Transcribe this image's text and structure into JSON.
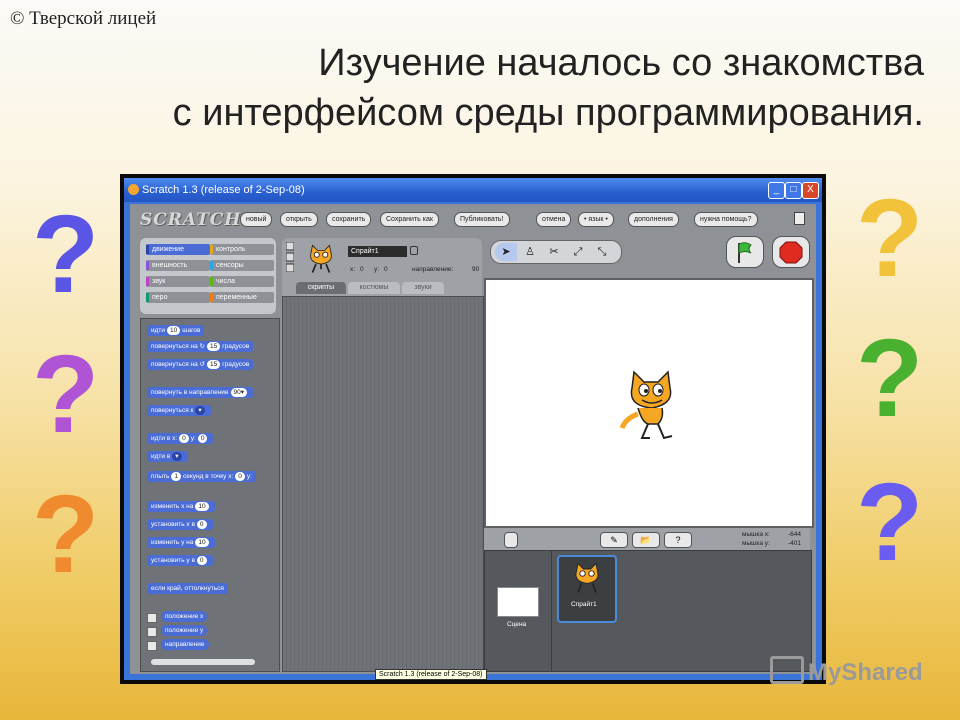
{
  "slide": {
    "copyright": "© Тверской лицей",
    "title_line1": "Изучение началось со знакомства",
    "title_line2": "с интерфейсом среды программирования.",
    "watermark": "MyShared",
    "question_mark": "?",
    "question_colors": {
      "left": [
        "#5b55e6",
        "#b054d6",
        "#f08a2e"
      ],
      "right": [
        "#f2c23a",
        "#49b030",
        "#6a5cf0"
      ]
    }
  },
  "window": {
    "title": "Scratch 1.3 (release of 2-Sep-08)",
    "controls": {
      "minimize": "_",
      "maximize": "□",
      "close": "X"
    },
    "tooltip": "Scratch 1.3 (release of 2-Sep-08)"
  },
  "scratch": {
    "logo": "SCRATCH",
    "menu": [
      "новый",
      "открыть",
      "сохранить",
      "Сохранить как",
      "Публиковать!",
      "отмена",
      "• язык •",
      "дополнения",
      "нужна помощь?"
    ],
    "categories": [
      {
        "label": "движение",
        "color": "#4a6cd4"
      },
      {
        "label": "контроль",
        "color": "#e1a91a"
      },
      {
        "label": "внешность",
        "color": "#8a55d7"
      },
      {
        "label": "сенсоры",
        "color": "#2ca5e2"
      },
      {
        "label": "звук",
        "color": "#bb42c3"
      },
      {
        "label": "числа",
        "color": "#5cb712"
      },
      {
        "label": "перо",
        "color": "#0e9a6c"
      },
      {
        "label": "переменные",
        "color": "#ee7d16"
      }
    ],
    "blocks": {
      "move_a": "идти",
      "move_n": "10",
      "move_b": "шагов",
      "turn_right_a": "повернуться на",
      "turn_right_sym": "↻",
      "turn_right_n": "15",
      "turn_right_b": "градусов",
      "turn_left_a": "повернуться на",
      "turn_left_sym": "↺",
      "turn_left_n": "15",
      "turn_left_b": "градусов",
      "point_dir_a": "повернуть в направление",
      "point_dir_n": "90▾",
      "point_to": "повернуться к",
      "point_to_slot": "▾",
      "goto_xy_a": "идти в x:",
      "goto_xy_x": "0",
      "goto_xy_b": "y:",
      "goto_xy_y": "0",
      "goto_a": "идти в",
      "goto_slot": "▾",
      "glide_a": "плыть",
      "glide_n": "1",
      "glide_b": "секунд в точку x:",
      "glide_x": "0",
      "glide_c": "у:",
      "change_x_a": "изменить х на",
      "change_x_n": "10",
      "set_x_a": "установить х в",
      "set_x_n": "0",
      "change_y_a": "изменить у на",
      "change_y_n": "10",
      "set_y_a": "установить у в",
      "set_y_n": "0",
      "bounce": "если край, оттолкнуться",
      "rep_x": "положение х",
      "rep_y": "положение у",
      "rep_dir": "направление"
    },
    "sprite": {
      "name": "Спрайт1",
      "x_label": "x:",
      "x_val": "0",
      "y_label": "y:",
      "y_val": "0",
      "dir_label": "направление:",
      "dir_val": "90"
    },
    "tabs": [
      "скрипты",
      "костюмы",
      "звуки"
    ],
    "mouse": {
      "x_label": "мышка x:",
      "x_val": "-644",
      "y_label": "мышка y:",
      "y_val": "-401"
    },
    "stage_label": "Сцена",
    "sprite_tile_label": "Спрайт1"
  }
}
